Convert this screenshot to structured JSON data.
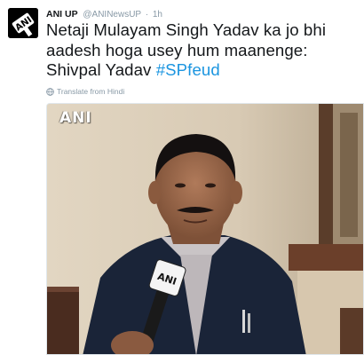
{
  "tweet": {
    "author_name": "ANI UP",
    "handle": "@ANINewsUP",
    "separator": "·",
    "time": "1h",
    "text_lines": [
      "Netaji Mulayam Singh Yadav ka jo bhi",
      "aadesh hoga usey hum maanenge:"
    ],
    "text_line3_prefix": "Shivpal Yadav ",
    "hashtag": "#SPfeud",
    "translate_label": "Translate from Hindi",
    "avatar_icon": "ani-logo-icon",
    "media_watermark": "ANI",
    "hashtag_color": "#1b95e0"
  }
}
